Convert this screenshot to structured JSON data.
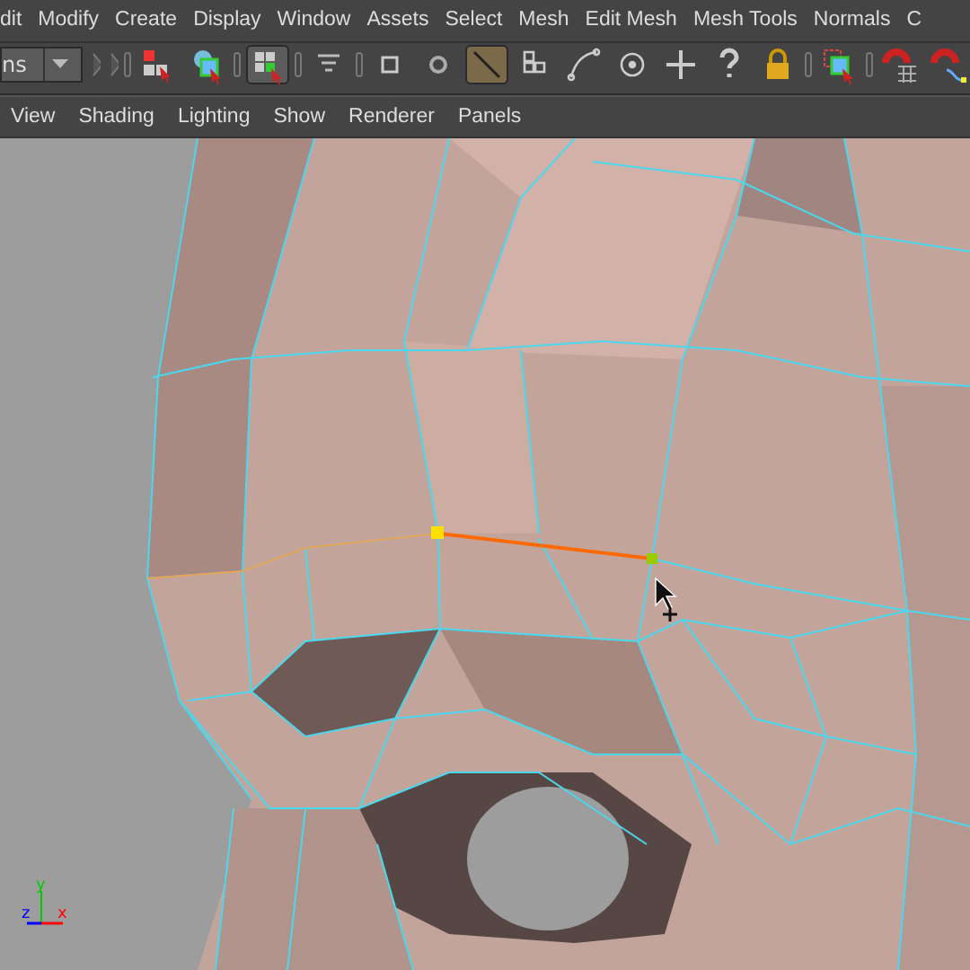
{
  "menu_bar": {
    "items": [
      "dit",
      "Modify",
      "Create",
      "Display",
      "Window",
      "Assets",
      "Select",
      "Mesh",
      "Edit Mesh",
      "Mesh Tools",
      "Normals",
      "C"
    ]
  },
  "toolbar": {
    "mode_dropdown": {
      "value": "ns"
    },
    "tools": [
      {
        "kind": "hierarchy",
        "selected": false
      },
      {
        "kind": "object",
        "selected": false
      },
      {
        "kind": "component",
        "selected": true
      },
      {
        "kind": "filter",
        "selected": false
      },
      {
        "kind": "square",
        "selected": false
      },
      {
        "kind": "circle",
        "selected": false
      },
      {
        "kind": "edge",
        "selected": true
      },
      {
        "kind": "grid",
        "selected": false
      },
      {
        "kind": "curve",
        "selected": false
      },
      {
        "kind": "point",
        "selected": false
      },
      {
        "kind": "plus",
        "selected": false
      },
      {
        "kind": "help",
        "selected": false
      },
      {
        "kind": "lock",
        "selected": false
      },
      {
        "kind": "select-box",
        "selected": false
      },
      {
        "kind": "magnet-grid",
        "selected": false
      },
      {
        "kind": "magnet-curve",
        "selected": false
      }
    ]
  },
  "panel_menu": {
    "items": [
      "View",
      "Shading",
      "Lighting",
      "Show",
      "Renderer",
      "Panels"
    ]
  },
  "viewport": {
    "axes": {
      "y": "y",
      "z": "z",
      "x": "x"
    }
  }
}
